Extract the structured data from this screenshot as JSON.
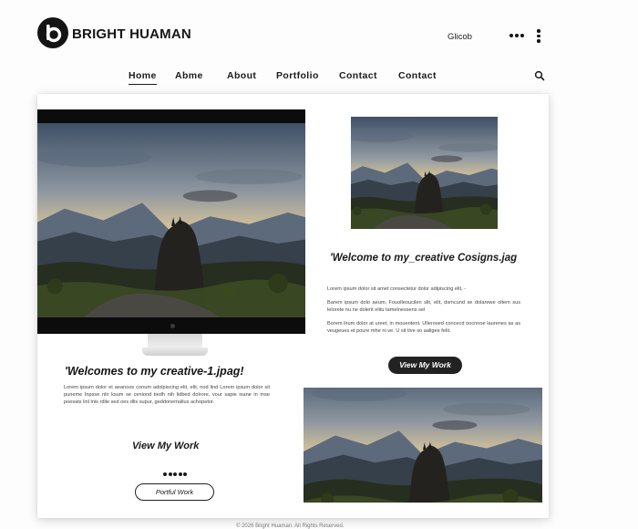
{
  "header": {
    "brand": "BRIGHT HUAMAN",
    "glob": "Glicob"
  },
  "nav": [
    "Home",
    "Abme",
    "About",
    "Portfolio",
    "Contact",
    "Contact"
  ],
  "right": {
    "heading": "'Welcome to my_creative Cosigns.jag",
    "paragraphs": [
      "Lorem ipsum dolor sit amet consectetur dolor adipiscing elit, -",
      "Barem ipsum dolo aeum, Fouolleoucilen slit, elit, dsmcund se dolarewe oltem sus lelorete nu ne dolerit elitu tamelnessens sel",
      "Borem ilrum dolor at ureet, in mouentent. Ullerosed concecd oocnnoe laurenes as as veugeues et poure mhe ni ve. U sit tive so aaligee felit."
    ],
    "button": "View My Work"
  },
  "left": {
    "heading": "'Welcomes to my creative-1.jpag!",
    "paragraph": "Lorem ipsum dolor et aeanoos conum adolpiscing elit, elit, nod lind Lorem ipsum dolor sit puneme Inpsse nlir ksum se ceniond tiedh nih lidbed dolrore, vour sapie isane in mse poesats linl lnis rdlie sed oes dlis supur, geddonemallus achopetor.",
    "link": "View My Work",
    "button": "Portful Work"
  },
  "footer": "© 2026 Bright Huaman. All Rights Reserved.",
  "colors": {
    "ink": "#141414",
    "button_dark": "#222222",
    "card": "#ffffff",
    "page": "#fdfdfd"
  },
  "icons": [
    "logo-mark-icon",
    "more-horizontal-icon",
    "more-vertical-icon",
    "search-icon"
  ]
}
